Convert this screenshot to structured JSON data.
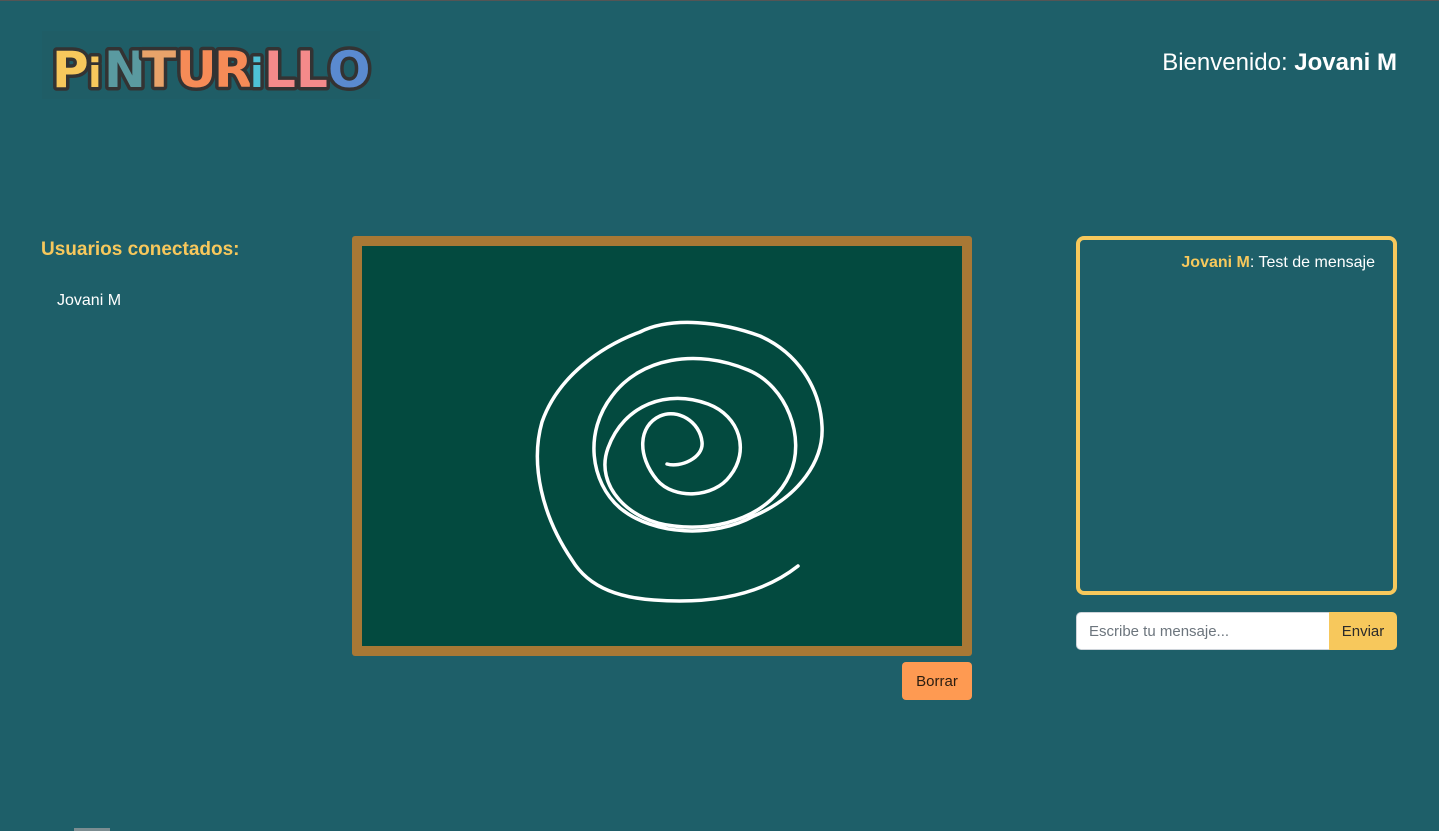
{
  "colors": {
    "background": "#1e5f69",
    "accent_yellow": "#f7c85c",
    "board_frame": "#a87835",
    "board_surface": "#034a3f",
    "clear_button": "#fe9a52"
  },
  "header": {
    "logo_text": "PiNTURiLLO",
    "welcome_label": "Bienvenido:",
    "welcome_user": "Jovani M"
  },
  "users": {
    "title": "Usuarios conectados:",
    "list": [
      "Jovani M"
    ]
  },
  "board": {
    "clear_label": "Borrar"
  },
  "chat": {
    "messages": [
      {
        "author": "Jovani M",
        "text": "Test de mensaje"
      }
    ],
    "input_placeholder": "Escribe tu mensaje...",
    "send_label": "Enviar"
  }
}
